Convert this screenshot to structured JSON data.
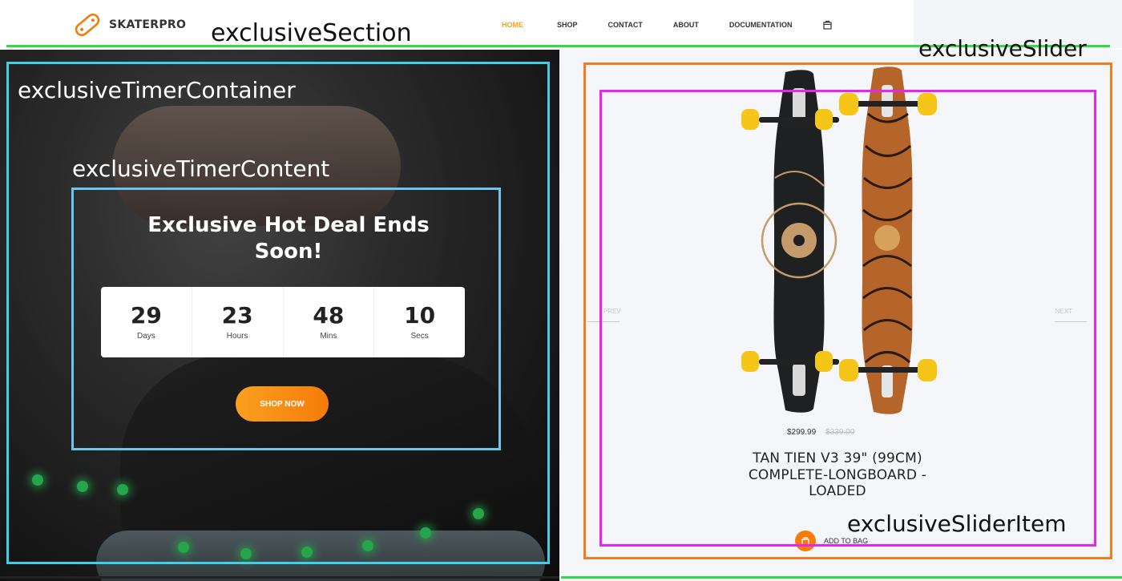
{
  "header": {
    "logo_text": "SKATERPRO",
    "nav": [
      {
        "label": "HOME",
        "active": true
      },
      {
        "label": "SHOP",
        "active": false
      },
      {
        "label": "CONTACT",
        "active": false
      },
      {
        "label": "ABOUT",
        "active": false
      },
      {
        "label": "DOCUMENTATION",
        "active": false
      }
    ],
    "cart_icon": "shopping-bag-icon"
  },
  "annotations": {
    "section": "exclusiveSection",
    "slider": "exclusiveSlider",
    "timer_container": "exclusiveTimerContainer",
    "timer_content": "exclusiveTimerContent",
    "slider_item": "exclusiveSliderItem"
  },
  "timer": {
    "title": "Exclusive Hot Deal Ends Soon!",
    "cells": [
      {
        "value": "29",
        "unit": "Days"
      },
      {
        "value": "23",
        "unit": "Hours"
      },
      {
        "value": "48",
        "unit": "Mins"
      },
      {
        "value": "10",
        "unit": "Secs"
      }
    ],
    "button_label": "SHOP NOW"
  },
  "slider": {
    "prev_label": "PREV",
    "next_label": "NEXT",
    "item": {
      "price": "$299.99",
      "old_price": "$339.00",
      "title": "TAN TIEN V3 39\" (99CM) COMPLETE-LONGBOARD - LOADED",
      "add_label": "ADD TO BAG"
    }
  },
  "colors": {
    "accent": "#f7a21b",
    "button_gradient_start": "#fba01f",
    "button_gradient_end": "#f67b0a",
    "annotation_green": "#35d845",
    "annotation_cyan": "#3fd0e8",
    "annotation_light_blue": "#6cc5f0",
    "annotation_orange": "#f07d22",
    "annotation_magenta": "#e825e8"
  }
}
